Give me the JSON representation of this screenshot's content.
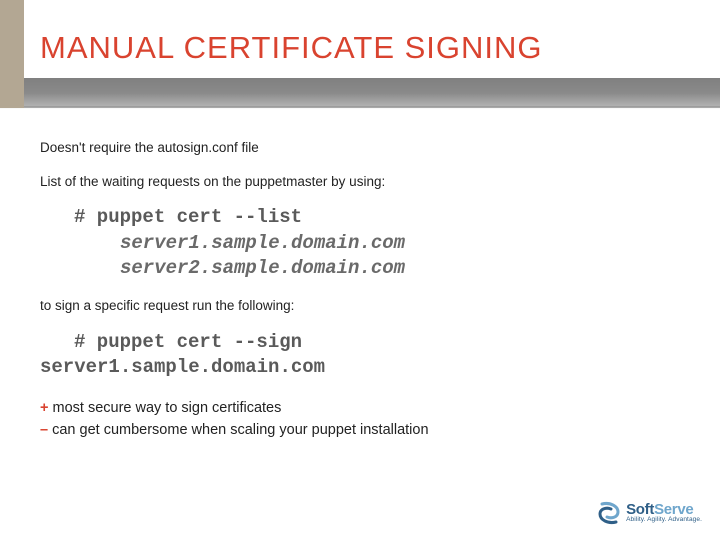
{
  "title": "MANUAL CERTIFICATE SIGNING",
  "body": {
    "p1": "Doesn't require the autosign.conf file",
    "p2": "List of the waiting requests on the puppetmaster by using:",
    "code1_cmd": "#  puppet cert --list",
    "code1_out1": "server1.sample.domain.com",
    "code1_out2": "server2.sample.domain.com",
    "p3": "to sign a specific request run the following:",
    "code2_cmd": "#  puppet cert --sign",
    "code2_out": "server1.sample.domain.com",
    "pro_mark": "+",
    "pro_text": " most secure way to sign certificates",
    "con_mark": "–",
    "con_text": " can get cumbersome when scaling your puppet installation"
  },
  "logo": {
    "brand_bold": "Soft",
    "brand_light": "Serve",
    "tagline": "Ability. Agility. Advantage."
  }
}
